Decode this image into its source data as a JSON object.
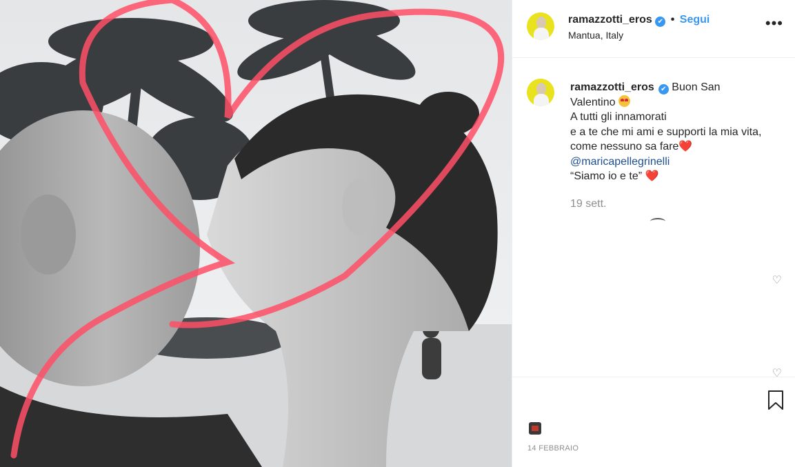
{
  "post": {
    "username": "ramazzotti_eros",
    "verified_mark": "✔",
    "separator": "•",
    "follow_label": "Segui",
    "location": "Mantua, Italy",
    "more_label": "•••"
  },
  "caption": {
    "username": "ramazzotti_eros",
    "verified_mark": "✔",
    "line1": "Buon San",
    "line2": "Valentino",
    "line3": "A tutti gli innamorati",
    "line4": "e a te che mi ami e supporti la mia vita,",
    "line5": "come nessuno sa fare",
    "mention": "@maricapellegrinelli",
    "line7": "“Siamo io e te”",
    "heart": "❤️",
    "time": "19 sett."
  },
  "comments": {
    "like_icon": "♡"
  },
  "footer": {
    "date": "14 FEBBRAIO"
  },
  "icons": {
    "verified": "verified-badge-icon",
    "more": "more-options-icon",
    "heart": "heart-icon",
    "bookmark": "bookmark-icon"
  },
  "colors": {
    "accent": "#3897f0",
    "mention": "#1d4f91",
    "heart_overlay": "#ff4f66",
    "muted": "#8e8e8e"
  }
}
